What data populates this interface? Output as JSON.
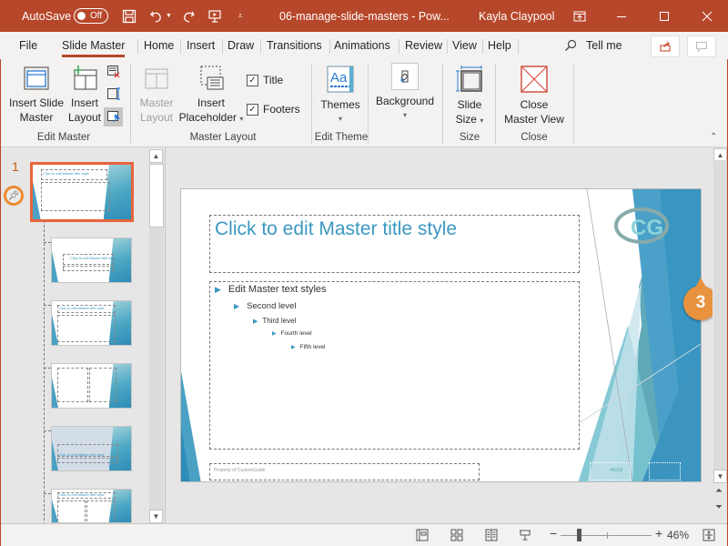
{
  "titlebar": {
    "autosave_label": "AutoSave",
    "autosave_state": "Off",
    "document_title": "06-manage-slide-masters  -  Pow...",
    "user_name": "Kayla Claypool",
    "icons": [
      "save-icon",
      "undo-icon",
      "redo-icon",
      "present-from-start-icon",
      "customize-qat-icon",
      "ribbon-display-options-icon",
      "minimize-icon",
      "maximize-icon",
      "close-icon"
    ]
  },
  "tabs": {
    "items": [
      "File",
      "Slide Master",
      "Home",
      "Insert",
      "Draw",
      "Transitions",
      "Animations",
      "Review",
      "View",
      "Help"
    ],
    "active": "Slide Master",
    "tell_me": "Tell me"
  },
  "ribbon": {
    "edit_master": {
      "label": "Edit Master",
      "insert_slide_master": [
        "Insert Slide",
        "Master"
      ],
      "insert_layout": [
        "Insert",
        "Layout"
      ]
    },
    "master_layout": {
      "label": "Master Layout",
      "master_layout_btn": [
        "Master",
        "Layout"
      ],
      "insert_placeholder": [
        "Insert",
        "Placeholder"
      ],
      "title_checkbox": {
        "label": "Title",
        "checked": true
      },
      "footers_checkbox": {
        "label": "Footers",
        "checked": true
      }
    },
    "edit_theme": {
      "label": "Edit Theme",
      "themes": "Themes"
    },
    "background": {
      "label": "Background"
    },
    "size": {
      "label": "Size",
      "slide_size": [
        "Slide",
        "Size"
      ]
    },
    "close": {
      "label": "Close",
      "close_master_view": [
        "Close",
        "Master View"
      ]
    }
  },
  "thumbnails": {
    "master_number": "1",
    "master_title": "Click to edit Master title style",
    "layouts": [
      {
        "title": "Click to edit Master title style",
        "kind": "title-slide"
      },
      {
        "title": "Click to edit Master title style",
        "kind": "title-content"
      },
      {
        "title": "",
        "kind": "two-content"
      },
      {
        "title": "Click to edit Master title style",
        "kind": "section-header"
      },
      {
        "title": "Click to edit Master title style",
        "kind": "comparison"
      }
    ]
  },
  "slide": {
    "title": "Click to edit Master title style",
    "bullets": [
      {
        "level": 1,
        "text": "Edit Master text styles"
      },
      {
        "level": 2,
        "text": "Second level"
      },
      {
        "level": 3,
        "text": "Third level"
      },
      {
        "level": 4,
        "text": "Fourth level"
      },
      {
        "level": 5,
        "text": "Fifth level"
      }
    ],
    "footer": "Property of CustomGuide",
    "date": "4/5/18",
    "logo": "CG"
  },
  "callout": {
    "step": "3"
  },
  "statusbar": {
    "zoom_percent": "46%",
    "zoom_value": 46,
    "views": [
      "normal-view",
      "slide-sorter-view",
      "reading-view",
      "slideshow-view"
    ]
  },
  "colors": {
    "accent": "#b7472a",
    "title_blue": "#3d98c3",
    "callout": "#e8923e",
    "selection": "#e8643c"
  }
}
